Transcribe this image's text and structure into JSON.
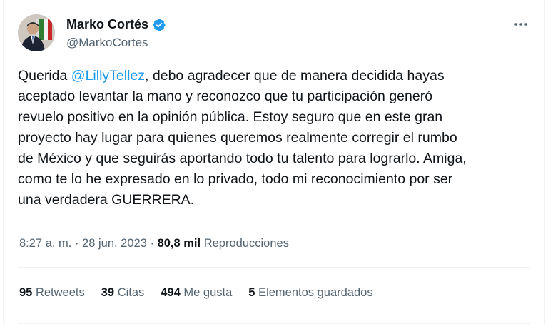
{
  "author": {
    "display_name": "Marko Cortés",
    "handle": "@MarkoCortes",
    "verified_icon": "verified-badge-icon",
    "avatar_icon": "profile-photo"
  },
  "tweet": {
    "text_before": "Querida ",
    "mention": "@LillyTellez",
    "text_after": ", debo agradecer que de manera decidida hayas\naceptado levantar la mano y reconozco que tu participación generó\nrevuelo positivo en la opinión pública. Estoy seguro que en este gran\nproyecto hay lugar para quienes queremos realmente corregir el rumbo\nde México y que seguirás aportando todo tu talento para lograrlo. Amiga,\ncomo te lo he expresado en lo privado, todo mi reconocimiento por ser\nuna verdadera GUERRERA."
  },
  "meta": {
    "time": "8:27 a. m.",
    "separator": " · ",
    "date": "28 jun. 2023",
    "views_count": "80,8 mil",
    "views_label": "Reproducciones"
  },
  "stats": {
    "retweets": {
      "num": "95",
      "label": "Retweets"
    },
    "quotes": {
      "num": "39",
      "label": "Citas"
    },
    "likes": {
      "num": "494",
      "label": "Me gusta"
    },
    "bookmarks": {
      "num": "5",
      "label": "Elementos guardados"
    }
  },
  "colors": {
    "accent": "#1d9bf0",
    "text_primary": "#0f1419",
    "text_secondary": "#536471",
    "border": "#eff3f4"
  },
  "icons": {
    "more": "more-options-icon"
  }
}
